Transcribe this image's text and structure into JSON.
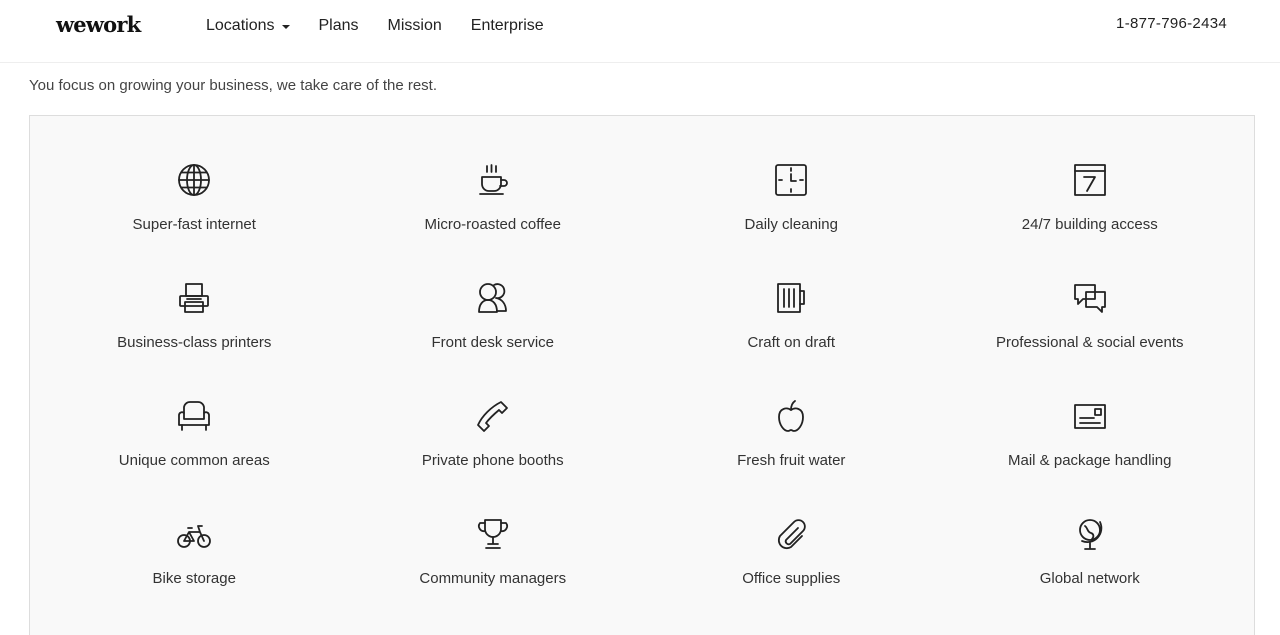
{
  "header": {
    "logo": "wework",
    "nav": [
      {
        "label": "Locations",
        "has_dropdown": true
      },
      {
        "label": "Plans"
      },
      {
        "label": "Mission"
      },
      {
        "label": "Enterprise"
      }
    ],
    "phone": "1-877-796-2434"
  },
  "main": {
    "tagline": "You focus on growing your business, we take care of the rest.",
    "amenities": [
      {
        "label": "Super-fast internet",
        "icon": "globe-icon"
      },
      {
        "label": "Micro-roasted coffee",
        "icon": "coffee-cup-icon"
      },
      {
        "label": "Daily cleaning",
        "icon": "clock-icon"
      },
      {
        "label": "24/7 building access",
        "icon": "calendar-icon"
      },
      {
        "label": "Business-class printers",
        "icon": "printer-icon"
      },
      {
        "label": "Front desk service",
        "icon": "people-icon"
      },
      {
        "label": "Craft on draft",
        "icon": "beer-mug-icon"
      },
      {
        "label": "Professional & social events",
        "icon": "chat-bubbles-icon"
      },
      {
        "label": "Unique common areas",
        "icon": "armchair-icon"
      },
      {
        "label": "Private phone booths",
        "icon": "phone-icon"
      },
      {
        "label": "Fresh fruit water",
        "icon": "apple-icon"
      },
      {
        "label": "Mail & package handling",
        "icon": "envelope-icon"
      },
      {
        "label": "Bike storage",
        "icon": "bicycle-icon"
      },
      {
        "label": "Community managers",
        "icon": "trophy-icon"
      },
      {
        "label": "Office supplies",
        "icon": "paperclip-icon"
      },
      {
        "label": "Global network",
        "icon": "desk-globe-icon"
      }
    ]
  },
  "colors": {
    "text": "#222222",
    "panel_bg": "#f9f9f9",
    "panel_border": "#dddddd"
  }
}
